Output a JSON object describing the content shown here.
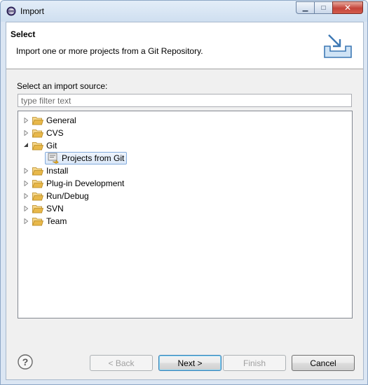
{
  "window": {
    "title": "Import",
    "minimize_glyph": "▁",
    "maximize_glyph": "□",
    "close_glyph": "✕"
  },
  "banner": {
    "title": "Select",
    "description": "Import one or more projects from a Git Repository.",
    "icon": "import-tray-icon"
  },
  "source": {
    "label": "Select an import source:",
    "filter_placeholder": "type filter text",
    "filter_value": ""
  },
  "tree": {
    "items": [
      {
        "label": "General",
        "expanded": false,
        "icon": "folder-icon"
      },
      {
        "label": "CVS",
        "expanded": false,
        "icon": "folder-icon"
      },
      {
        "label": "Git",
        "expanded": true,
        "icon": "folder-icon"
      },
      {
        "label": "Projects from Git",
        "child": true,
        "selected": true,
        "icon": "git-projects-icon"
      },
      {
        "label": "Install",
        "expanded": false,
        "icon": "folder-icon"
      },
      {
        "label": "Plug-in Development",
        "expanded": false,
        "icon": "folder-icon"
      },
      {
        "label": "Run/Debug",
        "expanded": false,
        "icon": "folder-icon"
      },
      {
        "label": "SVN",
        "expanded": false,
        "icon": "folder-icon"
      },
      {
        "label": "Team",
        "expanded": false,
        "icon": "folder-icon"
      }
    ]
  },
  "buttons": {
    "back": "< Back",
    "next": "Next >",
    "finish": "Finish",
    "cancel": "Cancel"
  },
  "colors": {
    "folder": "#e8b84a",
    "selection_border": "#84acdd",
    "close_button": "#c4443a"
  }
}
